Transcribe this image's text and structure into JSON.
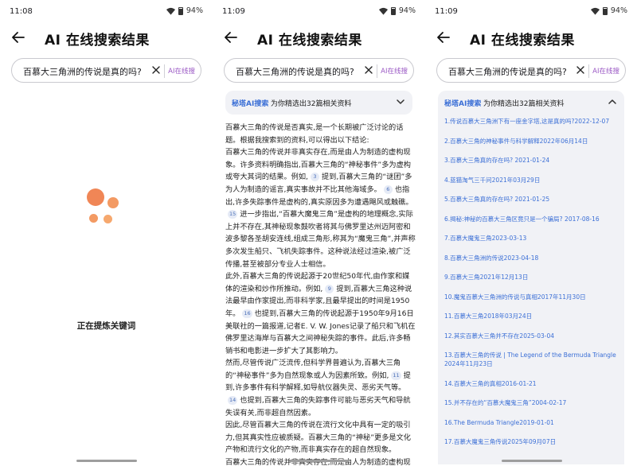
{
  "common": {
    "header_title": "AI 在线搜索结果",
    "search_value": "百慕大三角洲的传说是真的吗?",
    "ai_button": "AI在线搜",
    "battery": "94%"
  },
  "panel1": {
    "time": "11:08",
    "loading_text": "正在提炼关键词"
  },
  "panel2": {
    "time": "11:09",
    "source_brand": "秘塔AI搜索",
    "source_desc": "为你精选出32篇相关资料",
    "article": {
      "p1a": "百慕大三角的传说是否真实,是一个长期被广泛讨论的话题。根据我搜索到的资料,可以得出以下结论:",
      "p2a": "百慕大三角的传说并非真实存在,而是由人为制造的虚构现象。许多资料明确指出,百慕大三角的“神秘事件”多为虚构或夸大其词的结果。例如,",
      "c3": "3",
      "p2b": "提到,百慕大三角的“谜团”多为人为制造的谣言,真实事故并不比其他海域多。",
      "c6": "6",
      "p2c": "也指出,许多失踪事件是虚构的,真实原因多为遭遇飓风或触礁。",
      "c15": "15",
      "p2d": "进一步指出,“百慕大魔鬼三角”是虚构的地理概念,实际上并不存在,其神秘现象鼓吹者将其与佛罗里达州迈阿密和波多黎各圣胡安连线,组成三角形,称其为“魔鬼三角”,并声称多次发生船只、飞机失踪事件。这种说法经过渲染,被广泛传播,甚至被部分专业人士相信。",
      "p3a": "此外,百慕大三角的传说起源于20世纪50年代,由作家和媒体的渲染和炒作所推动。例如,",
      "c9": "9",
      "p3b": "提到,百慕大三角这种说法最早由作家提出,而非科学家,且最早提出的时间是1950年。",
      "c16": "16",
      "p3c": "也提到,百慕大三角的传说起源于1950年9月16日美联社的一篇报道,记者E. V. W. Jones记录了船只和飞机在佛罗里达海岸与百慕大之间神秘失踪的事件。此后,许多畅销书和电影进一步扩大了其影响力。",
      "p4a": "然而,尽管传说广泛流传,但科学界普遍认为,百慕大三角的“神秘事件”多为自然现象或人为因素所致。例如,",
      "c11": "11",
      "p4b": "提到,许多事件有科学解释,如导航仪器失灵、恶劣天气等。",
      "c14": "14",
      "p4c": "也提到,百慕大三角的失踪事件可能与恶劣天气和导航失误有关,而非超自然因素。",
      "p5": "因此,尽管百慕大三角的传说在流行文化中具有一定的吸引力,但其真实性应被质疑。百慕大三角的“神秘”更多是文化产物和流行文化的产物,而非真实存在的超自然现象。",
      "p6": "百慕大三角的传说并非真实存在,而是由人为制造的虚构现象。"
    }
  },
  "panel3": {
    "time": "11:09",
    "source_brand": "秘塔AI搜索",
    "source_desc": "为你精选出32篇相关资料",
    "sources": [
      "1.传说百慕大三角洲下有一座金字塔,这是真的吗?2022-12-07",
      "2.百慕大三角的神秘事件与科学解释2022年06月14日",
      "3.百慕大三角真的存在吗? 2021-01-24",
      "4.蓝猫淘气三千问2021年03月29日",
      "5.百慕大三角真的存在吗? 2021-01-25",
      "6.揭秘:神秘的百慕大三角区竟只是一个骗局? 2017-08-16",
      "7.百慕大魔鬼三角2023-03-13",
      "8.百慕大三角洲的传说2023-04-18",
      "9.百慕大三角2021年12月13日",
      "10.魔鬼百慕大三角洲的传说与真相2017年11月30日",
      "11.百慕大三角2018年03月24日",
      "12.其实百慕大三角并不存在2025-03-04",
      "13.百慕大三角的传说 | The Legend of the Bermuda Triangle2024年11月23日",
      "14.百慕大三角的真相2016-01-21",
      "15.并不存在的“百慕大魔鬼三角”2004-02-17",
      "16.The Bermuda Triangle2019-01-01",
      "17.百慕大魔鬼三角传说2025年09月07日"
    ]
  }
}
